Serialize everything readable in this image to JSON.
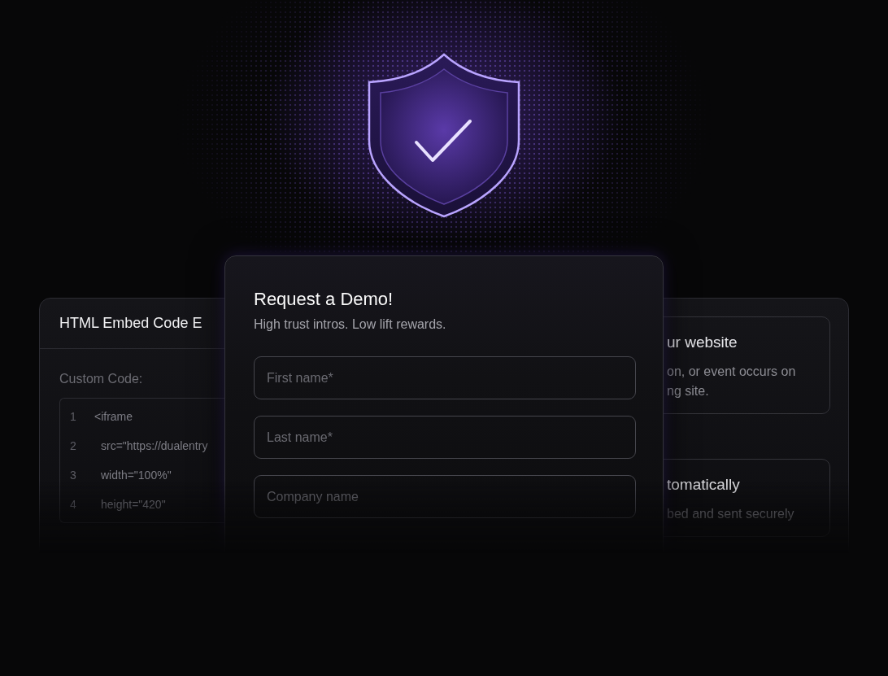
{
  "embed_card": {
    "title": "HTML Embed Code E",
    "label": "Custom Code:",
    "lines": [
      {
        "number": "1",
        "code": "<iframe",
        "indented": false
      },
      {
        "number": "2",
        "code": "src=\"https://dualentry",
        "indented": true
      },
      {
        "number": "3",
        "code": "width=\"100%\"",
        "indented": true
      },
      {
        "number": "4",
        "code": "height=\"420\"",
        "indented": true
      }
    ]
  },
  "demo_form": {
    "title": "Request a Demo!",
    "subtitle": "High trust intros. Low lift rewards.",
    "fields": [
      {
        "placeholder": "First name*"
      },
      {
        "placeholder": "Last name*"
      },
      {
        "placeholder": "Company name"
      }
    ]
  },
  "steps_card": {
    "steps": [
      {
        "title": "ur website",
        "lines": [
          "on, or event occurs on",
          "ng site."
        ]
      },
      {
        "title": "tomatically",
        "lines": [
          "bed and sent securely"
        ]
      }
    ]
  }
}
